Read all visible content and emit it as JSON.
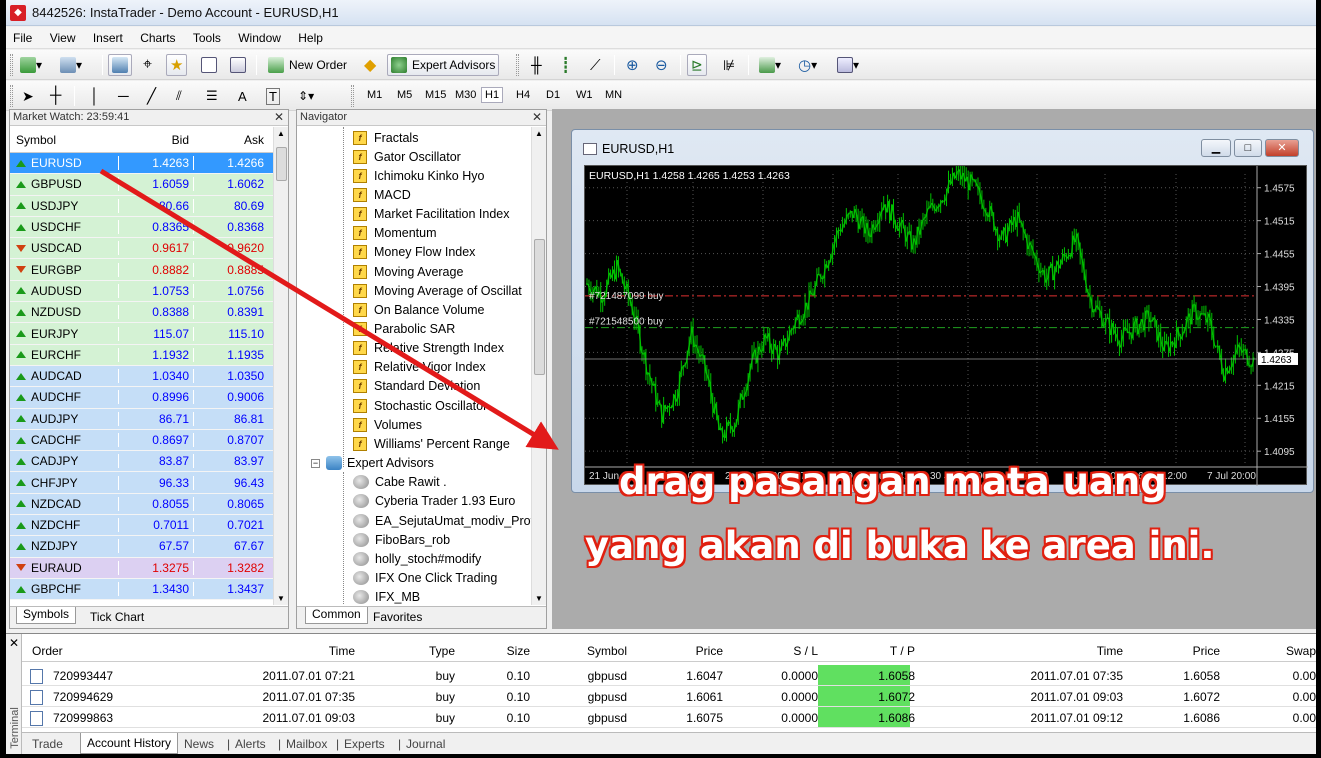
{
  "window": {
    "title": "8442526: InstaTrader - Demo Account - EURUSD,H1"
  },
  "menu": [
    "File",
    "View",
    "Insert",
    "Charts",
    "Tools",
    "Window",
    "Help"
  ],
  "toolbar": {
    "new_order": "New Order",
    "expert_advisors": "Expert Advisors"
  },
  "timeframes": {
    "items": [
      "M1",
      "M5",
      "M15",
      "M30",
      "H1",
      "H4",
      "D1",
      "W1",
      "MN"
    ],
    "active": "H1"
  },
  "market_watch": {
    "title": "Market Watch: 23:59:41",
    "headers": {
      "symbol": "Symbol",
      "bid": "Bid",
      "ask": "Ask"
    },
    "rows": [
      {
        "symbol": "EURUSD",
        "bid": "1.4263",
        "ask": "1.4266",
        "dir": "up"
      },
      {
        "symbol": "GBPUSD",
        "bid": "1.6059",
        "ask": "1.6062",
        "dir": "up"
      },
      {
        "symbol": "USDJPY",
        "bid": "80.66",
        "ask": "80.69",
        "dir": "up"
      },
      {
        "symbol": "USDCHF",
        "bid": "0.8365",
        "ask": "0.8368",
        "dir": "up"
      },
      {
        "symbol": "USDCAD",
        "bid": "0.9617",
        "ask": "0.9620",
        "dir": "down"
      },
      {
        "symbol": "EURGBP",
        "bid": "0.8882",
        "ask": "0.8885",
        "dir": "down"
      },
      {
        "symbol": "AUDUSD",
        "bid": "1.0753",
        "ask": "1.0756",
        "dir": "up"
      },
      {
        "symbol": "NZDUSD",
        "bid": "0.8388",
        "ask": "0.8391",
        "dir": "up"
      },
      {
        "symbol": "EURJPY",
        "bid": "115.07",
        "ask": "115.10",
        "dir": "up"
      },
      {
        "symbol": "EURCHF",
        "bid": "1.1932",
        "ask": "1.1935",
        "dir": "up"
      },
      {
        "symbol": "AUDCAD",
        "bid": "1.0340",
        "ask": "1.0350",
        "dir": "up"
      },
      {
        "symbol": "AUDCHF",
        "bid": "0.8996",
        "ask": "0.9006",
        "dir": "up"
      },
      {
        "symbol": "AUDJPY",
        "bid": "86.71",
        "ask": "86.81",
        "dir": "up"
      },
      {
        "symbol": "CADCHF",
        "bid": "0.8697",
        "ask": "0.8707",
        "dir": "up"
      },
      {
        "symbol": "CADJPY",
        "bid": "83.87",
        "ask": "83.97",
        "dir": "up"
      },
      {
        "symbol": "CHFJPY",
        "bid": "96.33",
        "ask": "96.43",
        "dir": "up"
      },
      {
        "symbol": "NZDCAD",
        "bid": "0.8055",
        "ask": "0.8065",
        "dir": "up"
      },
      {
        "symbol": "NZDCHF",
        "bid": "0.7011",
        "ask": "0.7021",
        "dir": "up"
      },
      {
        "symbol": "NZDJPY",
        "bid": "67.57",
        "ask": "67.67",
        "dir": "up"
      },
      {
        "symbol": "EURAUD",
        "bid": "1.3275",
        "ask": "1.3282",
        "dir": "down"
      },
      {
        "symbol": "GBPCHF",
        "bid": "1.3430",
        "ask": "1.3437",
        "dir": "up"
      }
    ],
    "tabs": [
      "Symbols",
      "Tick Chart"
    ]
  },
  "navigator": {
    "title": "Navigator",
    "indicators": [
      "Fractals",
      "Gator Oscillator",
      "Ichimoku Kinko Hyo",
      "MACD",
      "Market Facilitation Index",
      "Momentum",
      "Money Flow Index",
      "Moving Average",
      "Moving Average of Oscillat",
      "On Balance Volume",
      "Parabolic SAR",
      "Relative Strength Index",
      "Relative Vigor Index",
      "Standard Deviation",
      "Stochastic Oscillator",
      "Volumes",
      "Williams' Percent Range"
    ],
    "ea_folder": "Expert Advisors",
    "experts": [
      "Cabe Rawit .",
      "Cyberia Trader 1.93 Euro",
      "EA_SejutaUmat_modiv_Prot",
      "FiboBars_rob",
      "holly_stoch#modify",
      "IFX One Click Trading",
      "IFX_MB"
    ],
    "tabs": [
      "Common",
      "Favorites"
    ]
  },
  "chart_window": {
    "title": "EURUSD,H1",
    "header": "EURUSD,H1  1.4258 1.4265 1.4253 1.4263",
    "order1": "#721487099 buy",
    "order2": "#721548500 buy",
    "current_price": "1.4263",
    "price_ticks": [
      "1.4575",
      "1.4515",
      "1.4455",
      "1.4395",
      "1.4335",
      "1.4275",
      "1.4215",
      "1.4155",
      "1.4095"
    ],
    "time_ticks": [
      "21 Jun 2011",
      "22 Jun 04:00",
      "24 Jun 12:00",
      "27 Jun 20:00",
      "29 Jun 04:00",
      "30 Jun 12:00",
      "1 Jul 20:00",
      "5 Jul 04:00",
      "6 Jul 12:00",
      "7 Jul 20:00"
    ]
  },
  "chart_data": {
    "type": "candlestick",
    "title": "EURUSD,H1",
    "ylim": [
      4.4068,
      1.46
    ],
    "y_ticks": [
      1.4575,
      1.4515,
      1.4455,
      1.4395,
      1.4335,
      1.4275,
      1.4215,
      1.4155,
      1.4095
    ],
    "close_path": [
      1.44,
      1.438,
      1.443,
      1.436,
      1.425,
      1.416,
      1.42,
      1.431,
      1.424,
      1.412,
      1.415,
      1.425,
      1.43,
      1.427,
      1.433,
      1.437,
      1.443,
      1.45,
      1.453,
      1.449,
      1.455,
      1.451,
      1.447,
      1.453,
      1.456,
      1.46,
      1.458,
      1.454,
      1.448,
      1.452,
      1.446,
      1.441,
      1.444,
      1.448,
      1.437,
      1.433,
      1.43,
      1.432,
      1.434,
      1.428,
      1.431,
      1.435,
      1.433,
      1.424,
      1.428,
      1.426
    ],
    "current": 1.4263,
    "order_levels": [
      1.4378,
      1.432
    ]
  },
  "overlay": {
    "line1": "drag pasangan mata uang",
    "line2": "yang akan di buka ke area ini."
  },
  "terminal": {
    "label": "Terminal",
    "headers": [
      "Order",
      "Time",
      "Type",
      "Size",
      "Symbol",
      "Price",
      "S / L",
      "T / P",
      "Time",
      "Price",
      "Swap"
    ],
    "rows": [
      [
        "720993447",
        "2011.07.01 07:21",
        "buy",
        "0.10",
        "gbpusd",
        "1.6047",
        "0.0000",
        "1.6058",
        "2011.07.01 07:35",
        "1.6058",
        "0.00"
      ],
      [
        "720994629",
        "2011.07.01 07:35",
        "buy",
        "0.10",
        "gbpusd",
        "1.6061",
        "0.0000",
        "1.6072",
        "2011.07.01 09:03",
        "1.6072",
        "0.00"
      ],
      [
        "720999863",
        "2011.07.01 09:03",
        "buy",
        "0.10",
        "gbpusd",
        "1.6075",
        "0.0000",
        "1.6086",
        "2011.07.01 09:12",
        "1.6086",
        "0.00"
      ]
    ],
    "tabs": [
      "Trade",
      "Account History",
      "News",
      "Alerts",
      "Mailbox",
      "Experts",
      "Journal"
    ],
    "active_tab": "Account History"
  },
  "colors": {
    "bid_up": "#0000ff",
    "bid_down": "#e00000",
    "candle": "#00c000",
    "order_line_red": "#e03030",
    "order_line_green": "#20a020",
    "tp_cell": "#60e060"
  }
}
